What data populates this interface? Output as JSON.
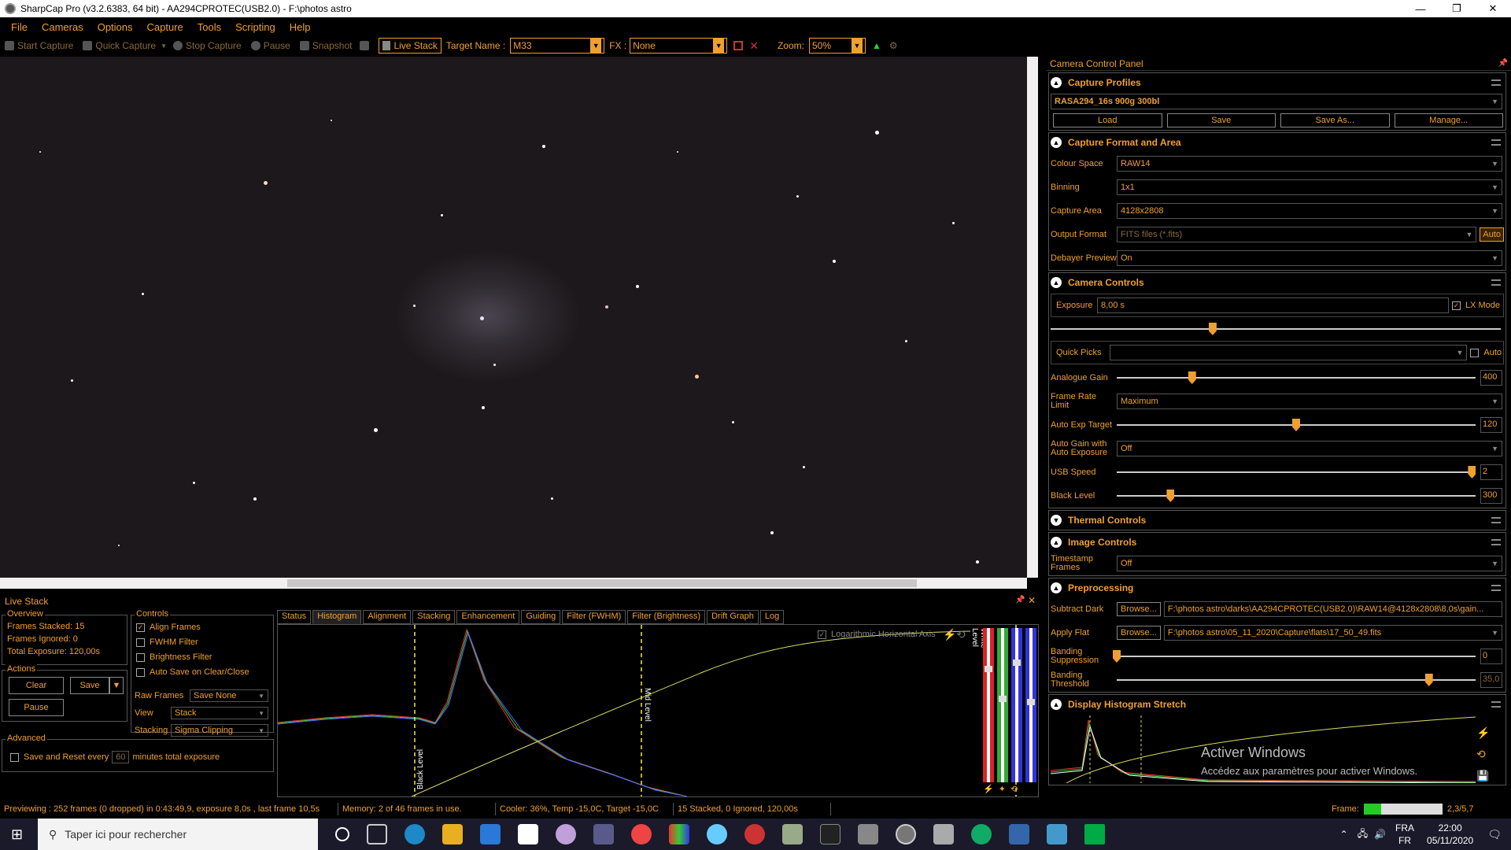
{
  "window": {
    "title": "SharpCap Pro (v3.2.6383, 64 bit) - AA294CPROTEC(USB2.0) - F:\\photos astro",
    "minimize": "—",
    "maximize": "❐",
    "close": "✕"
  },
  "menu": [
    "File",
    "Cameras",
    "Options",
    "Capture",
    "Tools",
    "Scripting",
    "Help"
  ],
  "toolbar": {
    "start_capture": "Start Capture",
    "quick_capture": "Quick Capture",
    "stop_capture": "Stop Capture",
    "pause": "Pause",
    "snapshot": "Snapshot",
    "live_stack": "Live Stack",
    "target_label": "Target Name :",
    "target_value": "M33",
    "fx_label": "FX :",
    "fx_value": "None",
    "zoom_label": "Zoom:",
    "zoom_value": "50%"
  },
  "camera_panel": {
    "title": "Camera Control Panel",
    "capture_profiles": {
      "header": "Capture Profiles",
      "selected": "RASA294_16s 900g 300bl",
      "buttons": [
        "Load",
        "Save",
        "Save As...",
        "Manage..."
      ]
    },
    "format": {
      "header": "Capture Format and Area",
      "colour_space_label": "Colour Space",
      "colour_space": "RAW14",
      "binning_label": "Binning",
      "binning": "1x1",
      "capture_area_label": "Capture Area",
      "capture_area": "4128x2808",
      "output_format_label": "Output Format",
      "output_format": "FITS files (*.fits)",
      "auto_btn": "Auto",
      "debayer_label": "Debayer Preview",
      "debayer": "On"
    },
    "controls": {
      "header": "Camera Controls",
      "exposure_label": "Exposure",
      "exposure": "8,00 s",
      "lx_mode": "LX Mode",
      "exposure_pos": 0.36,
      "quick_picks_label": "Quick Picks",
      "auto_label": "Auto",
      "gain_label": "Analogue Gain",
      "gain": "400",
      "gain_pos": 0.21,
      "frame_rate_label": "Frame Rate Limit",
      "frame_rate": "Maximum",
      "auto_exp_label": "Auto Exp Target",
      "auto_exp": "120",
      "auto_exp_pos": 0.5,
      "auto_gain_label": "Auto Gain with Auto Exposure",
      "auto_gain": "Off",
      "usb_label": "USB Speed",
      "usb": "2",
      "usb_pos": 0.99,
      "black_label": "Black Level",
      "black": "300",
      "black_pos": 0.15
    },
    "thermal": {
      "header": "Thermal Controls"
    },
    "image": {
      "header": "Image Controls",
      "timestamp_label": "Timestamp Frames",
      "timestamp": "Off"
    },
    "preproc": {
      "header": "Preprocessing",
      "dark_label": "Subtract Dark",
      "browse": "Browse...",
      "dark_path": "F:\\photos astro\\darks\\AA294CPROTEC(USB2.0)\\RAW14@4128x2808\\8,0s\\gain...",
      "flat_label": "Apply Flat",
      "flat_path": "F:\\photos astro\\05_11_2020\\Capture\\flats\\17_50_49.fits",
      "band_supp_label": "Banding Suppression",
      "band_supp": "0",
      "band_supp_pos": 0.0,
      "band_thr_label": "Banding Threshold",
      "band_thr": "35,0",
      "band_thr_pos": 0.87
    },
    "stretch": {
      "header": "Display Histogram Stretch"
    }
  },
  "livestack": {
    "title": "Live Stack",
    "overview_label": "Overview",
    "frames_stacked": "Frames Stacked:  15",
    "frames_ignored": "Frames Ignored:   0",
    "total_exposure": "Total Exposure:    120,00s",
    "actions_label": "Actions",
    "clear": "Clear",
    "save": "Save",
    "pause": "Pause",
    "controls_label": "Controls",
    "align_frames": "Align Frames",
    "fwhm_filter": "FWHM Filter",
    "brightness_filter": "Brightness Filter",
    "auto_save": "Auto Save on Clear/Close",
    "raw_frames_label": "Raw Frames",
    "raw_frames": "Save None",
    "view_label": "View",
    "view": "Stack",
    "stacking_label": "Stacking",
    "stacking": "Sigma Clipping",
    "advanced_label": "Advanced",
    "save_reset": "Save and Reset every",
    "minutes_value": "60",
    "minutes_label": "minutes total exposure",
    "tabs": [
      "Status",
      "Histogram",
      "Alignment",
      "Stacking",
      "Enhancement",
      "Guiding",
      "Filter (FWHM)",
      "Filter (Brightness)",
      "Drift Graph",
      "Log"
    ],
    "active_tab": "Histogram",
    "log_axis": "Logarithmic Horizontal Axis",
    "black_level": "Black Level",
    "mid_level": "Mid Level",
    "white_level": "White Level"
  },
  "status": {
    "preview": "Previewing : 252 frames (0 dropped) in 0:43:49,9, exposure 8,0s , last frame 10,5s",
    "memory": "Memory: 2 of 46 frames in use.",
    "cooler": "Cooler: 36%, Temp -15,0C, Target -15,0C",
    "stacked": "15 Stacked, 0 Ignored, 120,00s",
    "frame_label": "Frame:",
    "frame_value": "2,3/5,7"
  },
  "watermark": {
    "line1": "Activer Windows",
    "line2": "Accédez aux paramètres pour activer Windows."
  },
  "taskbar": {
    "search": "Taper ici pour rechercher",
    "lang1": "FRA",
    "lang2": "FR",
    "time": "22:00",
    "date": "05/11/2020"
  },
  "colors": {
    "accent": "#f0a030",
    "background": "#000000"
  }
}
